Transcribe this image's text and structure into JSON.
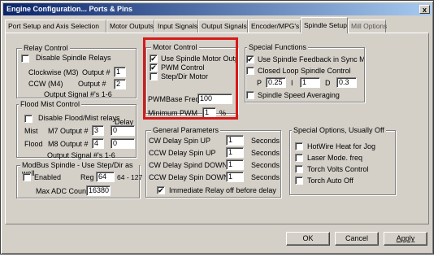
{
  "window": {
    "title": "Engine Configuration... Ports & Pins",
    "close": "x"
  },
  "tabs": [
    {
      "label": "Port Setup and Axis Selection"
    },
    {
      "label": "Motor Outputs"
    },
    {
      "label": "Input Signals"
    },
    {
      "label": "Output Signals"
    },
    {
      "label": "Encoder/MPG's"
    },
    {
      "label": "Spindle Setup"
    },
    {
      "label": "Mill Options"
    }
  ],
  "relay": {
    "legend": "Relay Control",
    "disable": "Disable Spindle Relays",
    "cw_label": "Clockwise (M3)",
    "cw_output_label": "Output #",
    "cw_value": "1",
    "ccw_label": "CCW (M4)",
    "ccw_output_label": "Output #",
    "ccw_value": "2",
    "note": "Output Signal #'s 1-6"
  },
  "flood": {
    "legend": "Flood Mist Control",
    "disable": "Disable Flood/Mist relays",
    "delay_label": "Delay",
    "mist_label": "Mist",
    "mist_output_label": "M7 Output #",
    "mist_value": "3",
    "mist_delay": "0",
    "flood_label": "Flood",
    "flood_output_label": "M8 Output #",
    "flood_value": "4",
    "flood_delay": "0",
    "note": "Output Signal #'s 1-6"
  },
  "modbus": {
    "legend": "ModBus Spindle - Use Step/Dir as well",
    "enabled": "Enabled",
    "reg_label": "Reg",
    "reg_value": "64",
    "reg_range": "64 - 127",
    "adc_label": "Max ADC Count",
    "adc_value": "16380"
  },
  "motor": {
    "legend": "Motor Control",
    "use_spindle": "Use Spindle Motor Output",
    "use_spindle_checked": "✔",
    "pwm": "PWM Control",
    "pwm_checked": "✔",
    "stepdir": "Step/Dir Motor",
    "pwmbase_label": "PWMBase Freq.",
    "pwmbase_value": "100",
    "minpwm_label": "Minimum PWM",
    "minpwm_value": "1",
    "minpwm_unit": "%"
  },
  "general": {
    "legend": "General Parameters",
    "rows": [
      {
        "label": "CW Delay Spin UP",
        "value": "1",
        "unit": "Seconds"
      },
      {
        "label": "CCW Delay Spin UP",
        "value": "1",
        "unit": "Seconds"
      },
      {
        "label": "CW Delay Spind DOWN",
        "value": "1",
        "unit": "Seconds"
      },
      {
        "label": "CCW Delay Spin DOWN",
        "value": "1",
        "unit": "Seconds"
      }
    ],
    "immediate": "Immediate Relay off before delay",
    "immediate_checked": "✔"
  },
  "special": {
    "legend": "Special Functions",
    "feedback": "Use Spindle Feedback in Sync Modes",
    "feedback_checked": "✔",
    "closed_loop": "Closed Loop Spindle Control",
    "p_label": "P",
    "p_value": "0.25",
    "i_label": "I",
    "i_value": "1",
    "d_label": "D",
    "d_value": "0.3",
    "averaging": "Spindle Speed Averaging"
  },
  "options": {
    "legend": "Special Options, Usually Off",
    "items": [
      {
        "label": "HotWire Heat for Jog"
      },
      {
        "label": "Laser Mode. freq"
      },
      {
        "label": "Torch Volts Control"
      },
      {
        "label": "Torch Auto Off"
      }
    ]
  },
  "buttons": {
    "ok": "OK",
    "cancel": "Cancel",
    "apply": "Apply"
  }
}
